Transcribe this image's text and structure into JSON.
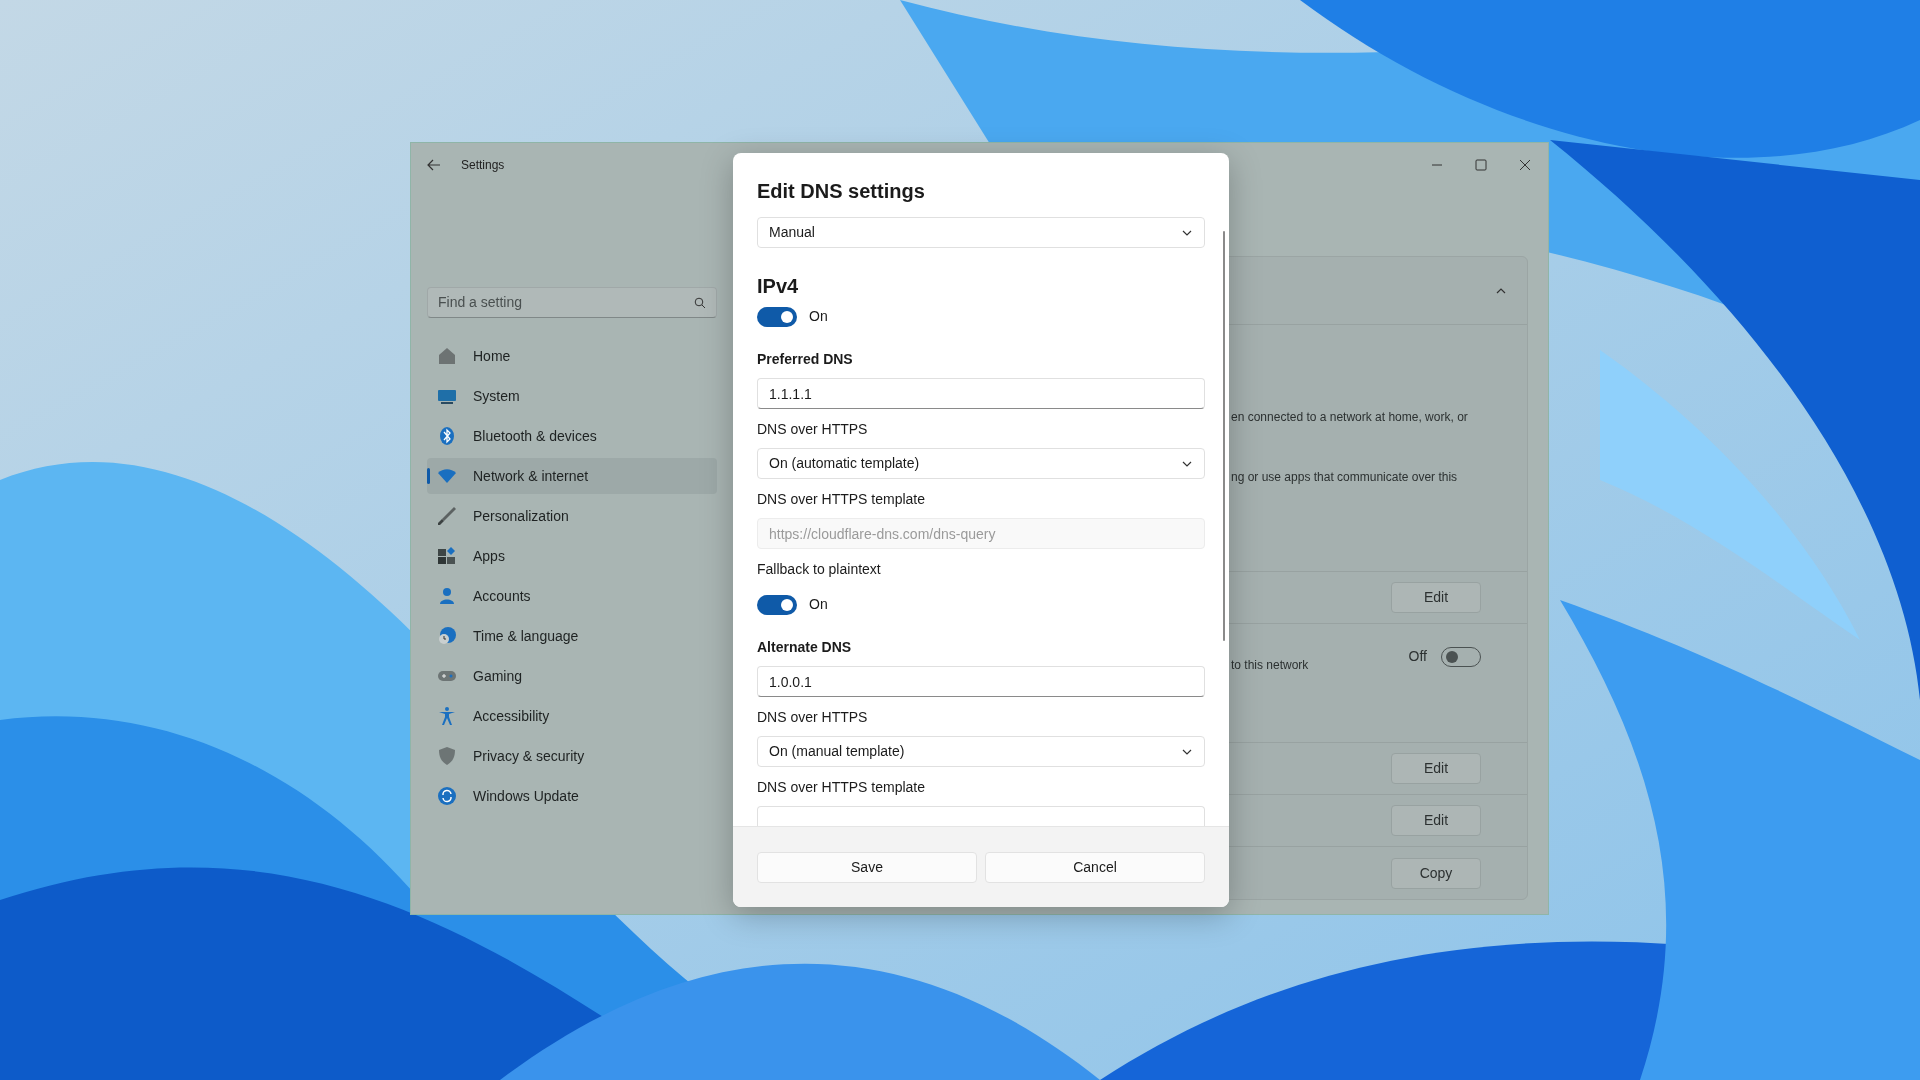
{
  "window": {
    "title": "Settings"
  },
  "sidebar": {
    "search": {
      "placeholder": "Find a setting"
    },
    "items": [
      {
        "label": "Home",
        "selected": false
      },
      {
        "label": "System",
        "selected": false
      },
      {
        "label": "Bluetooth & devices",
        "selected": false
      },
      {
        "label": "Network & internet",
        "selected": true
      },
      {
        "label": "Personalization",
        "selected": false
      },
      {
        "label": "Apps",
        "selected": false
      },
      {
        "label": "Accounts",
        "selected": false
      },
      {
        "label": "Time & language",
        "selected": false
      },
      {
        "label": "Gaming",
        "selected": false
      },
      {
        "label": "Accessibility",
        "selected": false
      },
      {
        "label": "Privacy & security",
        "selected": false
      },
      {
        "label": "Windows Update",
        "selected": false
      }
    ]
  },
  "content": {
    "expanded": true,
    "description_lines": [
      "en connected to a network at home, work, or",
      "ng or use apps that communicate over this"
    ],
    "rows": [
      {
        "kind": "button",
        "label": "Edit"
      },
      {
        "kind": "toggle",
        "text": "to this network",
        "state_label": "Off",
        "on": false
      },
      {
        "kind": "button",
        "label": "Edit"
      },
      {
        "kind": "button",
        "label": "Edit"
      },
      {
        "kind": "button",
        "label": "Copy"
      }
    ]
  },
  "dialog": {
    "title": "Edit DNS settings",
    "mode": "Manual",
    "items": [
      {
        "kind": "heading",
        "text": "IPv4"
      },
      {
        "kind": "toggle",
        "on": true,
        "label": "On"
      },
      {
        "kind": "label",
        "text": "Preferred DNS",
        "strong": true
      },
      {
        "kind": "input",
        "value": "1.1.1.1",
        "disabled": false
      },
      {
        "kind": "label",
        "text": "DNS over HTTPS",
        "strong": false
      },
      {
        "kind": "select",
        "value": "On (automatic template)"
      },
      {
        "kind": "label",
        "text": "DNS over HTTPS template",
        "strong": false
      },
      {
        "kind": "input",
        "placeholder": "https://cloudflare-dns.com/dns-query",
        "disabled": true
      },
      {
        "kind": "label",
        "text": "Fallback to plaintext",
        "strong": false
      },
      {
        "kind": "toggle",
        "on": true,
        "label": "On"
      },
      {
        "kind": "label",
        "text": "Alternate DNS",
        "strong": true
      },
      {
        "kind": "input",
        "value": "1.0.0.1",
        "disabled": false
      },
      {
        "kind": "label",
        "text": "DNS over HTTPS",
        "strong": false
      },
      {
        "kind": "select",
        "value": "On (manual template)"
      },
      {
        "kind": "label",
        "text": "DNS over HTTPS template",
        "strong": false
      },
      {
        "kind": "input",
        "disabled": false
      }
    ],
    "buttons": [
      "Save",
      "Cancel"
    ]
  }
}
